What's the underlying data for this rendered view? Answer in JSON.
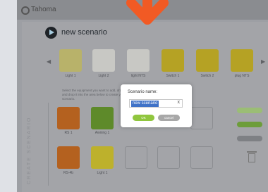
{
  "app": {
    "brand": "Tahoma"
  },
  "scenario": {
    "title": "new scenario"
  },
  "carousel": {
    "devices": [
      {
        "label": "Light 1",
        "icon": "bulb-icon"
      },
      {
        "label": "Light 2",
        "icon": "bulb-icon"
      },
      {
        "label": "light NTS",
        "icon": "bulb-icon"
      },
      {
        "label": "Switch 1",
        "icon": "plug-icon"
      },
      {
        "label": "Switch 2",
        "icon": "plug-icon"
      },
      {
        "label": "plug NTS",
        "icon": "plug-icon"
      }
    ]
  },
  "help": {
    "text": "Select the equipment you want to add, drag and drop it into the area below to create your scenario."
  },
  "workspace": {
    "vertical_label": "CREATE SCENARIO",
    "row1": [
      {
        "label": "RS 1",
        "icon": "shutter-icon"
      },
      {
        "label": "Awning 1",
        "icon": "awning-icon"
      }
    ],
    "row2": [
      {
        "label": "RS-4b",
        "icon": "shutter-icon"
      },
      {
        "label": "Light 1",
        "icon": "bulb-icon"
      }
    ],
    "side_buttons": [
      "",
      "",
      ""
    ]
  },
  "dialog": {
    "title": "Scenario name:",
    "input_value": "new scenario",
    "clear": "x",
    "ok_label": "OK",
    "cancel_label": "cancel"
  },
  "colors": {
    "accent": "#f15a24",
    "ok": "#90c63e"
  }
}
